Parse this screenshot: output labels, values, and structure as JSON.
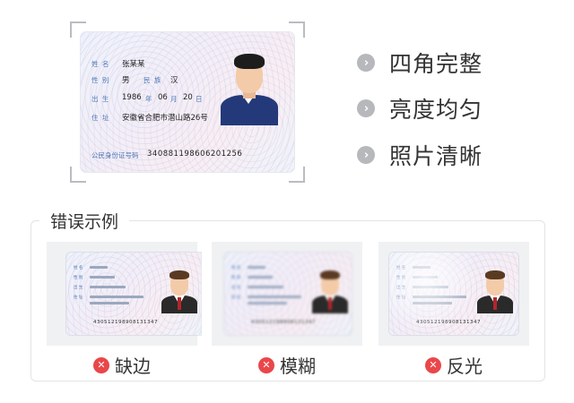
{
  "sample_card": {
    "name_label": "姓 名",
    "name_value": "张某某",
    "gender_label": "性 别",
    "gender_value": "男",
    "ethnicity_label": "民 族",
    "ethnicity_value": "汉",
    "birth_label": "出 生",
    "birth_year": "1986",
    "birth_year_unit": "年",
    "birth_month": "06",
    "birth_month_unit": "月",
    "birth_day": "20",
    "birth_day_unit": "日",
    "address_label": "住 址",
    "address_value": "安徽省合肥市潜山路26号",
    "id_label": "公民身份证号码",
    "id_value": "340881198606201256"
  },
  "requirements": [
    {
      "icon": "chevron-right-icon",
      "label": "四角完整"
    },
    {
      "icon": "chevron-right-icon",
      "label": "亮度均匀"
    },
    {
      "icon": "chevron-right-icon",
      "label": "照片清晰"
    }
  ],
  "wrong_examples": {
    "title": "错误示例",
    "items": [
      {
        "icon": "error-x-icon",
        "label": "缺边",
        "id_number": "430512198908131347"
      },
      {
        "icon": "error-x-icon",
        "label": "模糊",
        "id_number": "430512198908131347"
      },
      {
        "icon": "error-x-icon",
        "label": "反光",
        "id_number": "430512198908131347"
      }
    ]
  },
  "colors": {
    "label_blue": "#4c77b5",
    "error_red": "#e9474a",
    "check_gray": "#b6b8bc",
    "suit_navy": "#23397a",
    "suit_dark": "#2a2a2a"
  }
}
